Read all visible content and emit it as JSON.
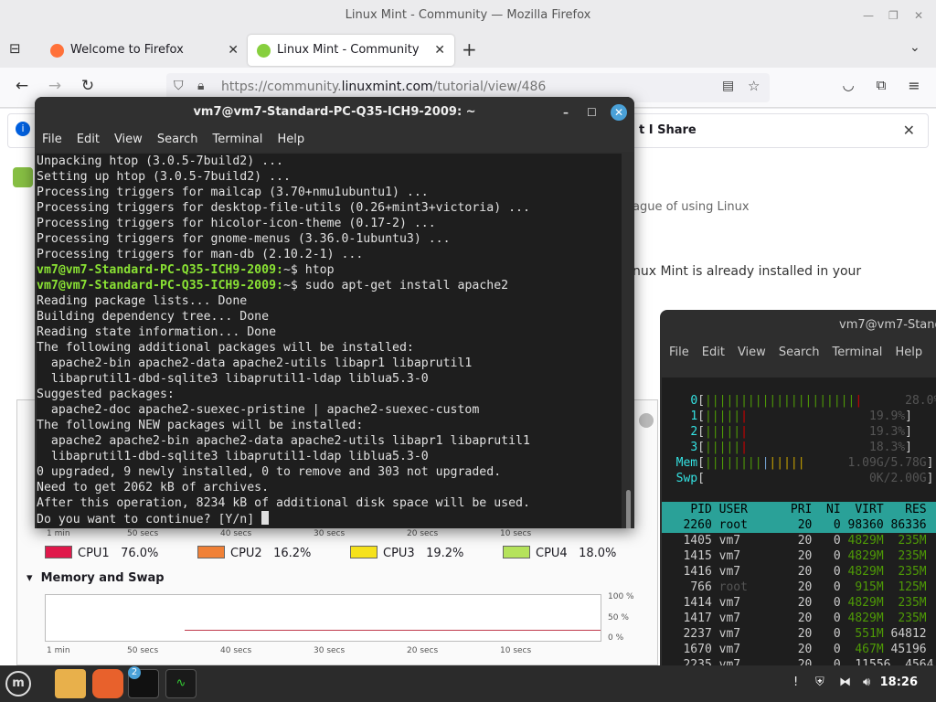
{
  "firefox": {
    "window_title": "Linux Mint - Community — Mozilla Firefox",
    "tabs": [
      {
        "label": "Welcome to Firefox"
      },
      {
        "label": "Linux Mint - Community"
      }
    ],
    "url_prefix": "https://community.",
    "url_domain": "linuxmint.com",
    "url_path": "/tutorial/view/486",
    "notification_share": "t I Share",
    "page_text_1": "nux Mint is already installed in your",
    "page_text_0": "ague of using Linux"
  },
  "terminal1": {
    "title": "vm7@vm7-Standard-PC-Q35-ICH9-2009: ~",
    "menu": [
      "File",
      "Edit",
      "View",
      "Search",
      "Terminal",
      "Help"
    ],
    "lines_before": [
      "Unpacking htop (3.0.5-7build2) ...",
      "Setting up htop (3.0.5-7build2) ...",
      "Processing triggers for mailcap (3.70+nmu1ubuntu1) ...",
      "Processing triggers for desktop-file-utils (0.26+mint3+victoria) ...",
      "Processing triggers for hicolor-icon-theme (0.17-2) ...",
      "Processing triggers for gnome-menus (3.36.0-1ubuntu3) ...",
      "Processing triggers for man-db (2.10.2-1) ..."
    ],
    "prompt": "vm7@vm7-Standard-PC-Q35-ICH9-2009:",
    "cmd1": "~$ htop",
    "cmd2": "~$ sudo apt-get install apache2",
    "lines_after": [
      "Reading package lists... Done",
      "Building dependency tree... Done",
      "Reading state information... Done",
      "The following additional packages will be installed:",
      "  apache2-bin apache2-data apache2-utils libapr1 libaprutil1",
      "  libaprutil1-dbd-sqlite3 libaprutil1-ldap liblua5.3-0",
      "Suggested packages:",
      "  apache2-doc apache2-suexec-pristine | apache2-suexec-custom",
      "The following NEW packages will be installed:",
      "  apache2 apache2-bin apache2-data apache2-utils libapr1 libaprutil1",
      "  libaprutil1-dbd-sqlite3 libaprutil1-ldap liblua5.3-0",
      "0 upgraded, 9 newly installed, 0 to remove and 303 not upgraded.",
      "Need to get 2062 kB of archives.",
      "After this operation, 8234 kB of additional disk space will be used.",
      "Do you want to continue? [Y/n] "
    ]
  },
  "terminal2": {
    "title": "vm7@vm7-Stand",
    "menu": [
      "File",
      "Edit",
      "View",
      "Search",
      "Terminal",
      "Help"
    ],
    "meters": [
      {
        "label": "0",
        "pct": "28.0%"
      },
      {
        "label": "1",
        "pct": "19.9%"
      },
      {
        "label": "2",
        "pct": "19.3%"
      },
      {
        "label": "3",
        "pct": "18.3%"
      },
      {
        "label": "Mem",
        "pct": "1.09G/5.78G"
      },
      {
        "label": "Swp",
        "pct": "0K/2.00G"
      }
    ],
    "header": {
      "pid": "PID",
      "user": "USER",
      "pri": "PRI",
      "ni": "NI",
      "virt": "VIRT",
      "res": "RES"
    },
    "rows": [
      {
        "pid": "2260",
        "user": "root",
        "pri": "20",
        "ni": "0",
        "virt": "98360",
        "res": "86336"
      },
      {
        "pid": "1405",
        "user": "vm7",
        "pri": "20",
        "ni": "0",
        "virt": "4829M",
        "res": "235M"
      },
      {
        "pid": "1415",
        "user": "vm7",
        "pri": "20",
        "ni": "0",
        "virt": "4829M",
        "res": "235M"
      },
      {
        "pid": "1416",
        "user": "vm7",
        "pri": "20",
        "ni": "0",
        "virt": "4829M",
        "res": "235M"
      },
      {
        "pid": "766",
        "user": "root",
        "pri": "20",
        "ni": "0",
        "virt": "915M",
        "res": "125M"
      },
      {
        "pid": "1414",
        "user": "vm7",
        "pri": "20",
        "ni": "0",
        "virt": "4829M",
        "res": "235M"
      },
      {
        "pid": "1417",
        "user": "vm7",
        "pri": "20",
        "ni": "0",
        "virt": "4829M",
        "res": "235M"
      },
      {
        "pid": "2237",
        "user": "vm7",
        "pri": "20",
        "ni": "0",
        "virt": "551M",
        "res": "64812"
      },
      {
        "pid": "1670",
        "user": "vm7",
        "pri": "20",
        "ni": "0",
        "virt": "467M",
        "res": "45196"
      },
      {
        "pid": "2235",
        "user": "vm7",
        "pri": "20",
        "ni": "0",
        "virt": "11556",
        "res": "4564"
      }
    ]
  },
  "sysmon": {
    "cpu_legend": [
      {
        "label": "CPU1",
        "value": "76.0%",
        "color": "#e0194b"
      },
      {
        "label": "CPU2",
        "value": "16.2%",
        "color": "#f08137"
      },
      {
        "label": "CPU3",
        "value": "19.2%",
        "color": "#f6e21c"
      },
      {
        "label": "CPU4",
        "value": "18.0%",
        "color": "#b5e35b"
      }
    ],
    "memory_title": "Memory and Swap",
    "time_ticks": [
      "1 min",
      "50 secs",
      "40 secs",
      "30 secs",
      "20 secs",
      "10 secs"
    ],
    "pct_ticks": [
      "100 %",
      "50 %",
      "0 %"
    ]
  },
  "taskbar": {
    "clock": "18:26",
    "terminal_badge": "2"
  }
}
